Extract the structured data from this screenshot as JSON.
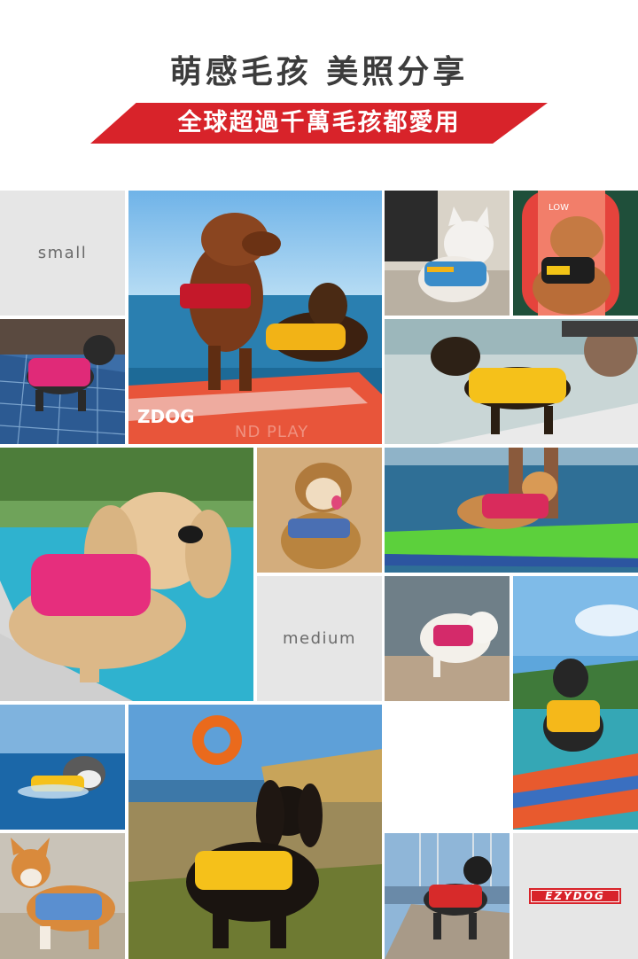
{
  "header": {
    "title": "萌感毛孩 美照分享",
    "banner": "全球超過千萬毛孩都愛用"
  },
  "labels": {
    "small": "small",
    "medium": "medium"
  },
  "brand": {
    "logo_text": "EZYDOG",
    "accent": "#d8232a"
  },
  "photos": [
    {
      "id": "dachshunds-paddleboard"
    },
    {
      "id": "cat-blue-vest"
    },
    {
      "id": "poodle-surfboard"
    },
    {
      "id": "french-bulldog-pink-vest"
    },
    {
      "id": "dachshund-yellow-vest-sup"
    },
    {
      "id": "longhair-dachshund-pool"
    },
    {
      "id": "fluffy-dog-beach"
    },
    {
      "id": "shiba-pink-vest-board"
    },
    {
      "id": "pomeranian-pink-vest"
    },
    {
      "id": "shiba-yellow-vest-sup"
    },
    {
      "id": "husky-swimming"
    },
    {
      "id": "spaniel-yellow-vest"
    },
    {
      "id": "corgi-blue-vest"
    },
    {
      "id": "dog-red-vest-dock"
    }
  ]
}
